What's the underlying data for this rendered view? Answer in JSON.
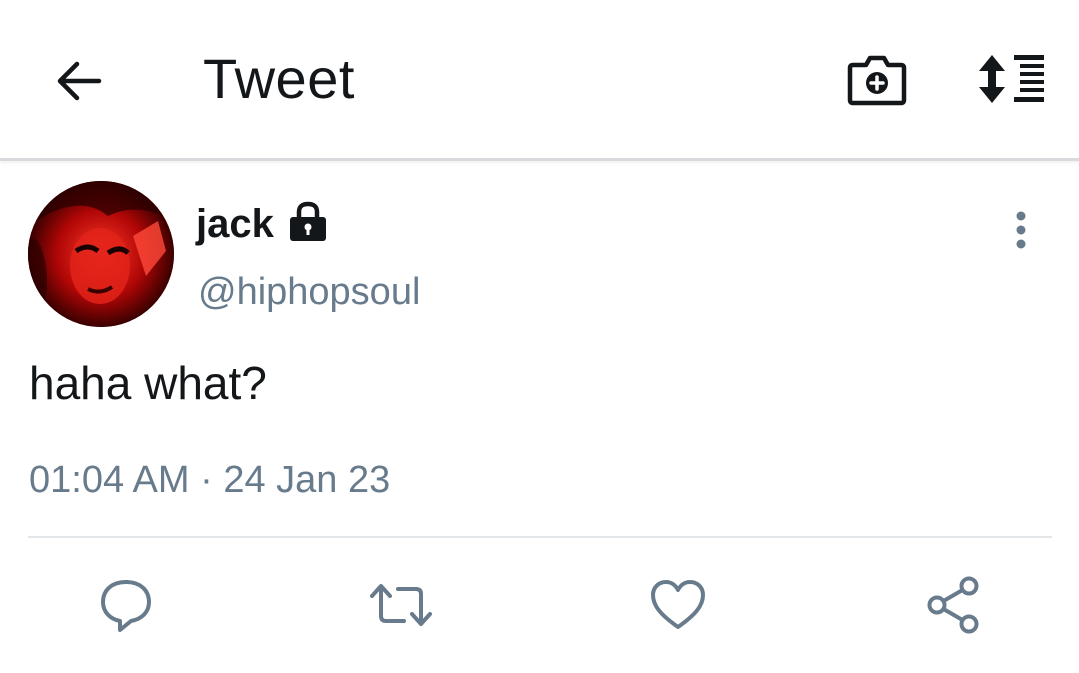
{
  "header": {
    "title": "Tweet",
    "back_icon": "arrow-left-icon",
    "camera_icon": "camera-plus-icon",
    "sort_icon": "sort-list-icon"
  },
  "tweet": {
    "display_name": "jack",
    "protected_icon": "lock-icon",
    "username": "@hiphopsoul",
    "text": "haha what?",
    "timestamp": "01:04 AM · 24 Jan 23",
    "more_icon": "more-vertical-icon"
  },
  "actions": {
    "reply_icon": "reply-icon",
    "retweet_icon": "retweet-icon",
    "like_icon": "heart-icon",
    "share_icon": "share-icon"
  },
  "colors": {
    "primary_text": "#14171a",
    "secondary_text": "#687b8c",
    "divider": "#e3e6e9",
    "avatar_red": "#c00000"
  }
}
